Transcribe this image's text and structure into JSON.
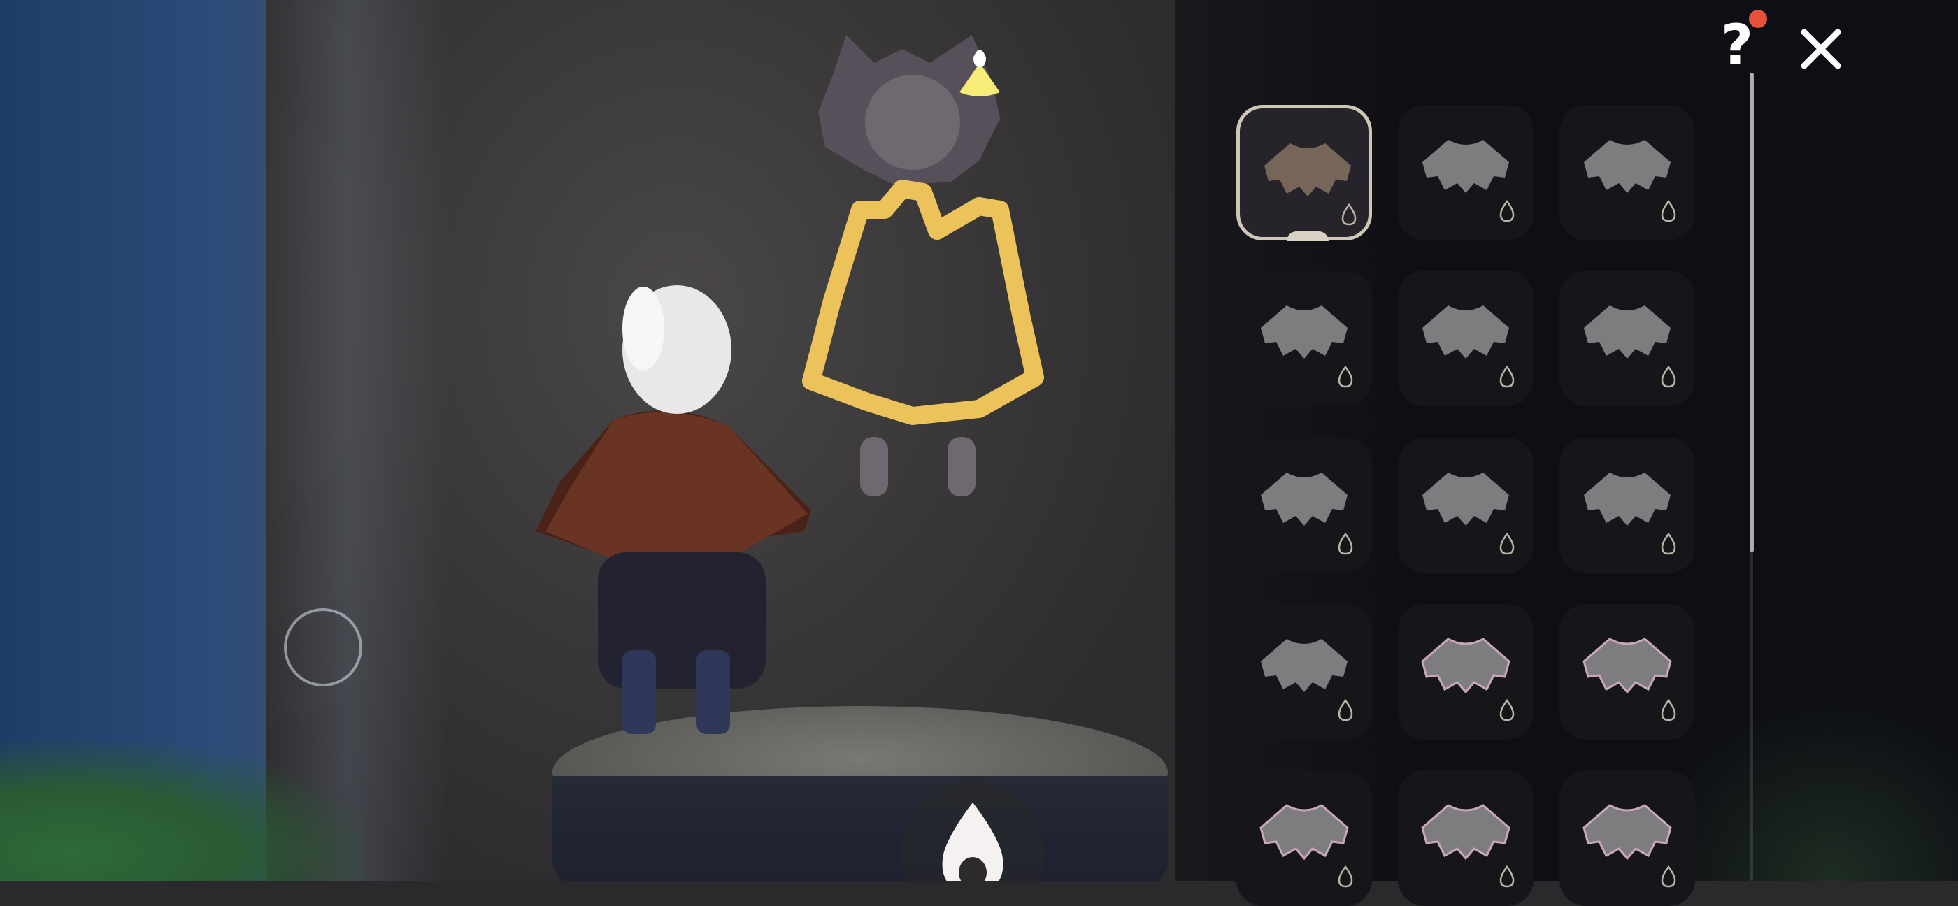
{
  "scene": {
    "character": "player-character-with-cape",
    "mural": "cape-outfit-mural",
    "accent_color": "#ecc25a"
  },
  "hud": {
    "joystick_icon": "joystick-ring-icon",
    "candle_icon": "candle-flame-icon",
    "indicator_icon": "light-cone-indicator-icon"
  },
  "panel": {
    "help_label": "?",
    "help_badge_color": "#e8503c",
    "close_icon": "close-icon",
    "selected_index": 0,
    "slots": [
      {
        "id": "cape-1",
        "style": "short",
        "color": "#76665a"
      },
      {
        "id": "cape-2",
        "style": "short",
        "color": "#7d7d80"
      },
      {
        "id": "cape-3",
        "style": "short",
        "color": "#7d7d80"
      },
      {
        "id": "cape-4",
        "style": "short",
        "color": "#7d7d80"
      },
      {
        "id": "cape-5",
        "style": "short",
        "color": "#7d7d80"
      },
      {
        "id": "cape-6",
        "style": "short",
        "color": "#7d7d80"
      },
      {
        "id": "cape-7",
        "style": "short",
        "color": "#7d7d80"
      },
      {
        "id": "cape-8",
        "style": "short",
        "color": "#7d7d80"
      },
      {
        "id": "cape-9",
        "style": "short",
        "color": "#7d7d80"
      },
      {
        "id": "cape-10",
        "style": "short",
        "color": "#7d7d80"
      },
      {
        "id": "cape-11",
        "style": "trimmed",
        "color": "#7d7d80"
      },
      {
        "id": "cape-12",
        "style": "trimmed",
        "color": "#7d7d80"
      },
      {
        "id": "cape-13",
        "style": "trimmed",
        "color": "#7d7d80"
      },
      {
        "id": "cape-14",
        "style": "trimmed",
        "color": "#7d7d80"
      },
      {
        "id": "cape-15",
        "style": "trimmed",
        "color": "#7d7d80"
      }
    ]
  }
}
